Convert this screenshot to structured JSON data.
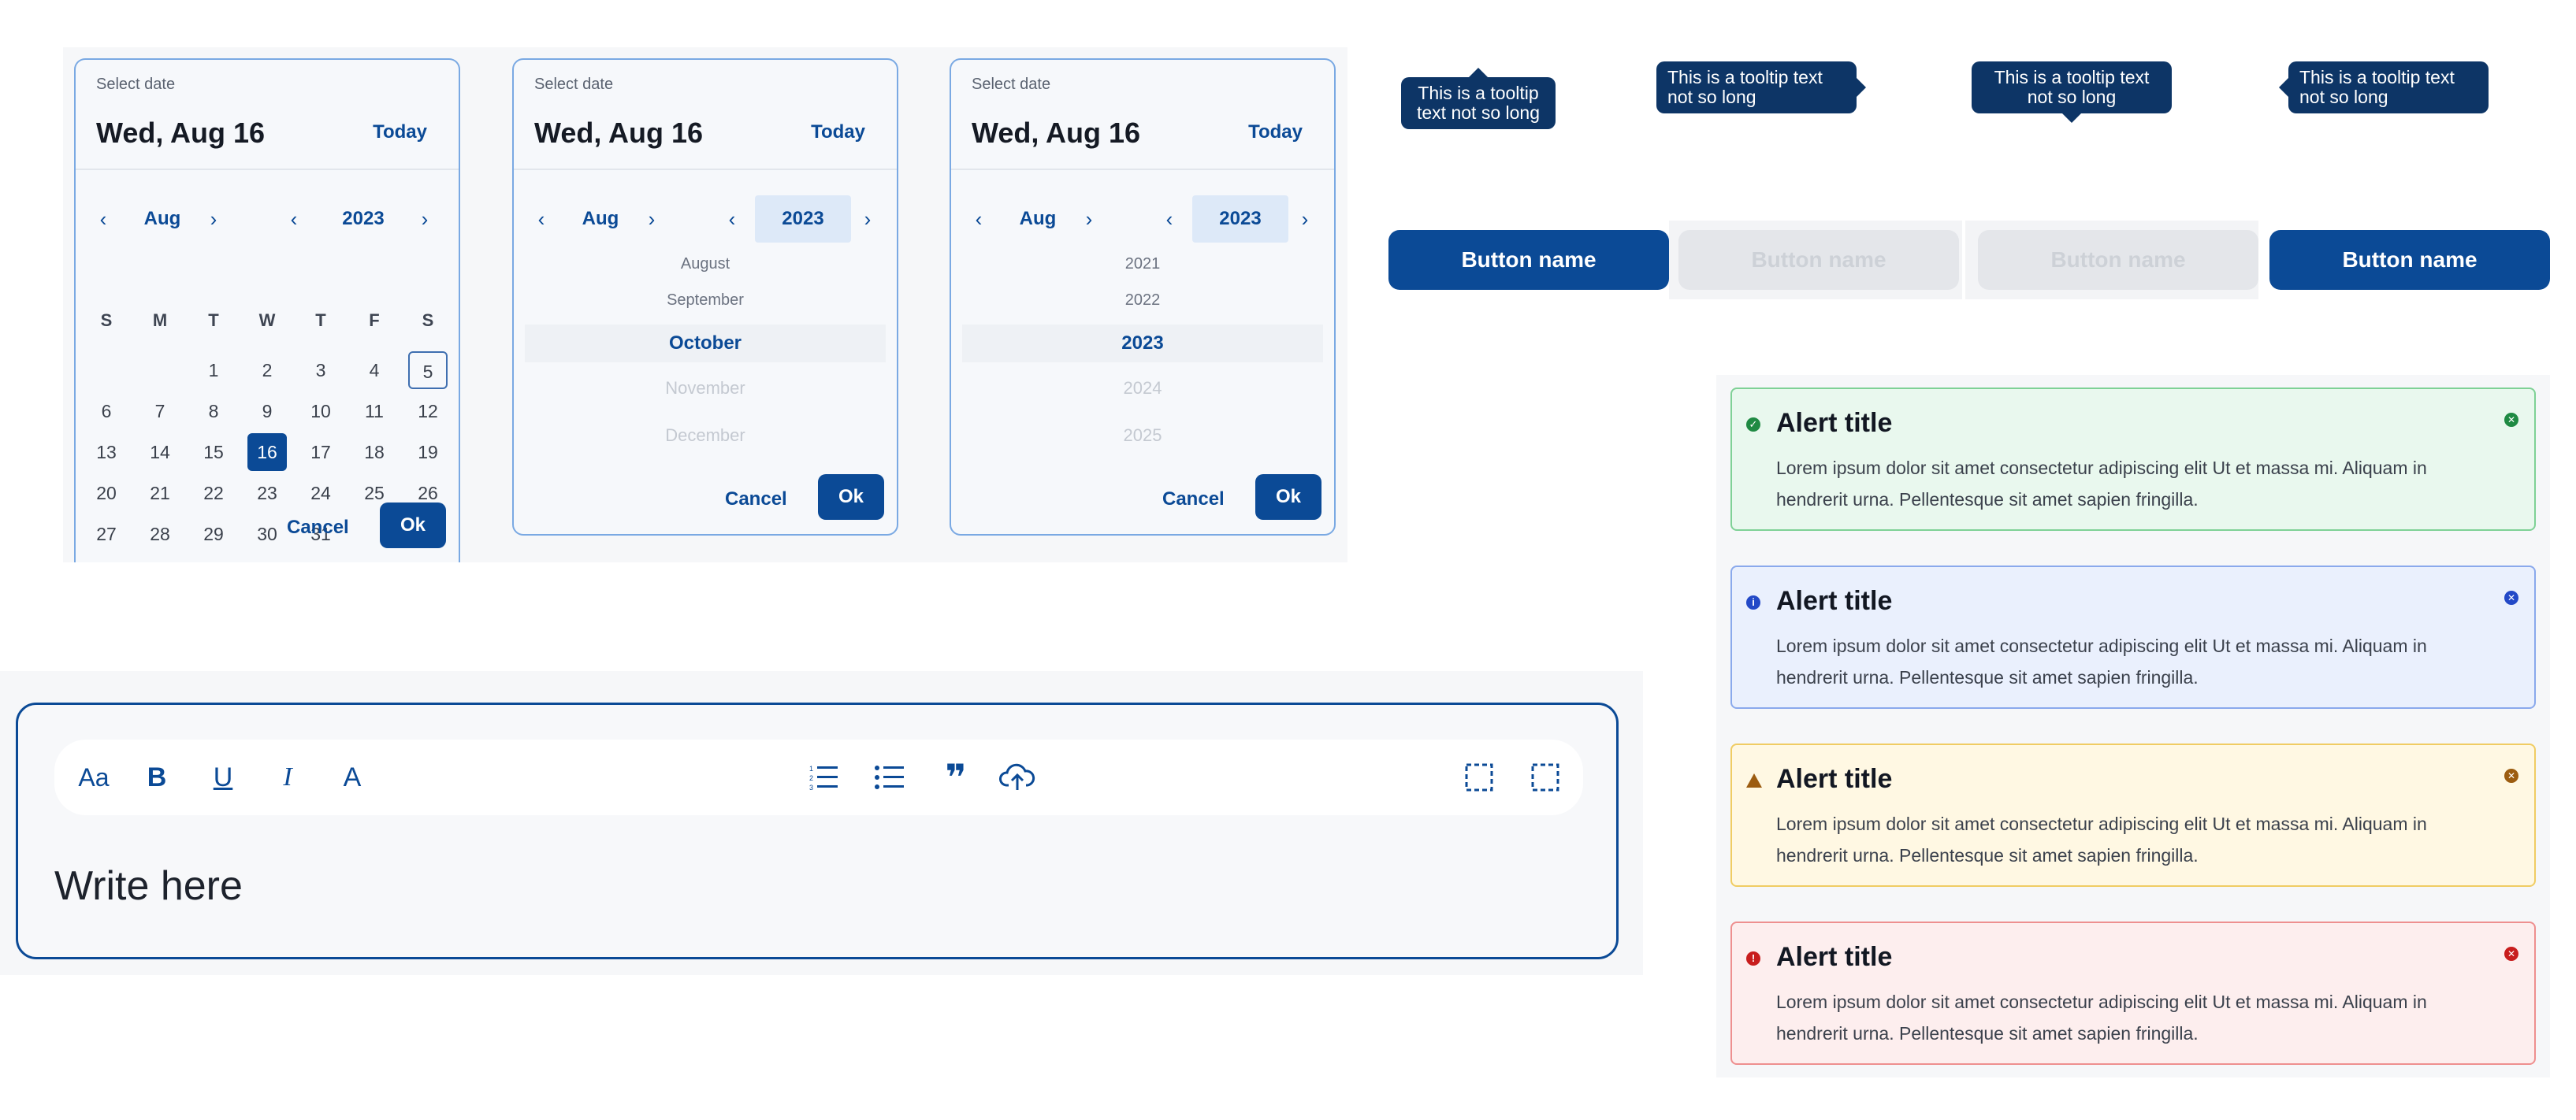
{
  "datepickers": [
    {
      "label": "Select date",
      "date": "Wed, Aug 16",
      "today": "Today",
      "month": "Aug",
      "year": "2023",
      "weekdays": [
        "S",
        "M",
        "T",
        "W",
        "T",
        "F",
        "S"
      ],
      "weeks": [
        [
          "",
          "",
          "1",
          "2",
          "3",
          "4",
          "5"
        ],
        [
          "6",
          "7",
          "8",
          "9",
          "10",
          "11",
          "12"
        ],
        [
          "13",
          "14",
          "15",
          "16",
          "17",
          "18",
          "19"
        ],
        [
          "20",
          "21",
          "22",
          "23",
          "24",
          "25",
          "26"
        ],
        [
          "27",
          "28",
          "29",
          "30",
          "31",
          "",
          ""
        ]
      ],
      "today_day": "5",
      "selected_day": "16",
      "cancel": "Cancel",
      "ok": "Ok"
    },
    {
      "label": "Select date",
      "date": "Wed, Aug 16",
      "today": "Today",
      "month": "Aug",
      "year": "2023",
      "wheel": [
        "August",
        "September",
        "October",
        "November",
        "December"
      ],
      "cancel": "Cancel",
      "ok": "Ok"
    },
    {
      "label": "Select date",
      "date": "Wed, Aug 16",
      "today": "Today",
      "month": "Aug",
      "year": "2023",
      "wheel": [
        "2021",
        "2022",
        "2023",
        "2024",
        "2025"
      ],
      "cancel": "Cancel",
      "ok": "Ok"
    }
  ],
  "nav_icons": {
    "prev": "‹",
    "next": "›"
  },
  "tooltips": [
    {
      "text_line1": "This is a tooltip",
      "text_line2": "text not so long",
      "arrow": "up"
    },
    {
      "text_line1": "This is a tooltip text",
      "text_line2": "not so long",
      "arrow": "right"
    },
    {
      "text_line1": "This is a tooltip text",
      "text_line2": "not so long",
      "arrow": "down"
    },
    {
      "text_line1": "This is a tooltip text",
      "text_line2": "not so long",
      "arrow": "left"
    }
  ],
  "buttons": [
    {
      "label": "Button name",
      "state": "primary"
    },
    {
      "label": "Button name",
      "state": "disabled"
    },
    {
      "label": "Button name",
      "state": "disabled"
    },
    {
      "label": "Button name",
      "state": "primary"
    }
  ],
  "alerts": [
    {
      "type": "success",
      "title": "Alert title",
      "body": "Lorem ipsum dolor sit amet consectetur adipiscing elit Ut et massa mi. Aliquam in hendrerit urna. Pellentesque sit amet sapien fringilla.",
      "bg": "#e9f8ee",
      "border": "#7fd196",
      "icon_color": "#1f8a43",
      "icon": "✓"
    },
    {
      "type": "info",
      "title": "Alert title",
      "body": "Lorem ipsum dolor sit amet consectetur adipiscing elit Ut et massa mi. Aliquam in hendrerit urna. Pellentesque sit amet sapien fringilla.",
      "bg": "#eaf0fd",
      "border": "#8aa9ec",
      "icon_color": "#2349c7",
      "icon": "i"
    },
    {
      "type": "warning",
      "title": "Alert title",
      "body": "Lorem ipsum dolor sit amet consectetur adipiscing elit Ut et massa mi. Aliquam in hendrerit urna. Pellentesque sit amet sapien fringilla.",
      "bg": "#fff8e3",
      "border": "#f0cc63",
      "icon_color": "#9c5c10",
      "icon": "!"
    },
    {
      "type": "error",
      "title": "Alert title",
      "body": "Lorem ipsum dolor sit amet consectetur adipiscing elit Ut et massa mi. Aliquam in hendrerit urna. Pellentesque sit amet sapien fringilla.",
      "bg": "#fdeeee",
      "border": "#ee8f8f",
      "icon_color": "#c81d1d",
      "icon": "!"
    }
  ],
  "editor": {
    "placeholder": "Write here",
    "tools": [
      {
        "name": "font-size-icon",
        "glyph": "Aa"
      },
      {
        "name": "bold-icon",
        "glyph": "B"
      },
      {
        "name": "underline-icon",
        "glyph": "U"
      },
      {
        "name": "italic-icon",
        "glyph": "I"
      },
      {
        "name": "text-color-icon",
        "glyph": "A"
      },
      {
        "name": "numbered-list-icon",
        "glyph": ""
      },
      {
        "name": "bullet-list-icon",
        "glyph": ""
      },
      {
        "name": "quote-icon",
        "glyph": "❞"
      },
      {
        "name": "upload-icon",
        "glyph": ""
      },
      {
        "name": "select-area-icon",
        "glyph": ""
      },
      {
        "name": "fullscreen-icon",
        "glyph": ""
      }
    ]
  },
  "colors": {
    "primary": "#0b4a96",
    "tooltip": "#0d3566"
  }
}
